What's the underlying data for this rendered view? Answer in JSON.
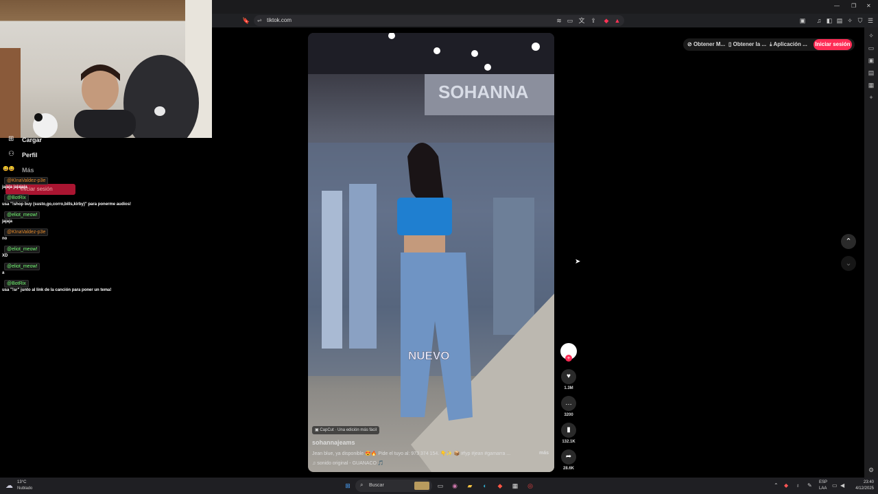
{
  "browser": {
    "url": "tiktok.com",
    "window_controls": [
      "—",
      "□",
      "✕"
    ]
  },
  "tiktok_header": {
    "items": [
      "Obtener M...",
      "Obtener la ...",
      "Aplicación ..."
    ],
    "login_button": "Iniciar sesión"
  },
  "left_menu": {
    "items": [
      {
        "label": "Cargar"
      },
      {
        "label": "Perfil"
      },
      {
        "label": "Más"
      }
    ],
    "login_button": "Iniciar sesión"
  },
  "chat": [
    {
      "user": "@KInaValdez-p3e",
      "color": "orange",
      "message": "jajaja jajajaja"
    },
    {
      "user": "@BotRix",
      "color": "green",
      "message": "usa \"!shop buy (susto,go,corro,bills,kirby)\" para ponerme audios!"
    },
    {
      "user": "@eliot_meow!",
      "color": "green",
      "message": "jajaja"
    },
    {
      "user": "@KInaValdez-p3e",
      "color": "orange",
      "message": "no"
    },
    {
      "user": "@eliot_meow!",
      "color": "green",
      "message": "XD"
    },
    {
      "user": "@eliot_meow!",
      "color": "green",
      "message": "a"
    },
    {
      "user": "@BotRix",
      "color": "green",
      "message": "usa \"!sr\" junto al link de la canción para poner un tema!"
    }
  ],
  "video": {
    "overlay_text": "NUEVO",
    "capcut_badge": "CapCut · Una edición más fácil",
    "author": "sohannajeams",
    "caption": "Jean blue, ya disponible 😍🔥 Pide el tuyo al: 973 374 154. 👇✨ 📦 #fyp #jean #gamarra ...",
    "more": "más",
    "sound": "sonido original - GUANACO 🎵",
    "store_sign": "SOHANNA"
  },
  "actions": {
    "likes": "1.3M",
    "comments": "3200",
    "saves": "132.1K",
    "shares": "28.6K"
  },
  "taskbar": {
    "weather_temp": "13°C",
    "weather_desc": "Nublado",
    "search_placeholder": "Buscar",
    "lang": "ESP",
    "lang_sub": "LAA",
    "time": "23:40",
    "date": "4/12/2025"
  },
  "colors": {
    "accent": "#fe2c55",
    "chat_green": "#77ff77",
    "chat_orange": "#e98c2c"
  }
}
